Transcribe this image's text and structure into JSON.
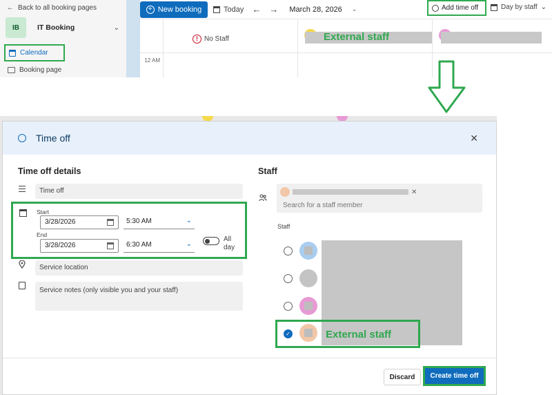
{
  "sidebar": {
    "back_label": "Back to all booking pages",
    "org_initials": "IB",
    "org_name": "IT Booking",
    "items": [
      {
        "label": "Calendar"
      },
      {
        "label": "Booking page"
      }
    ]
  },
  "toolbar": {
    "new_booking": "New booking",
    "today": "Today",
    "date": "March 28, 2026",
    "add_time_off": "Add time off",
    "view_mode": "Day by staff"
  },
  "calendar": {
    "no_staff_label": "No Staff",
    "external_staff_label": "External staff",
    "time_label": "12 AM"
  },
  "dialog": {
    "title": "Time off",
    "details_title": "Time off details",
    "title_field_value": "Time off",
    "start_label": "Start",
    "start_date": "3/28/2026",
    "start_time": "5:30 AM",
    "end_label": "End",
    "end_date": "3/28/2026",
    "end_time": "6:30 AM",
    "all_day_label": "All day",
    "all_day_on": false,
    "location_placeholder": "Service location",
    "notes_placeholder": "Service notes (only visible you and your staff)",
    "staff_title": "Staff",
    "staff_search_placeholder": "Search for a staff member",
    "staff_list_label": "Staff",
    "staff_list": [
      {
        "avatar_color": "#a9cdef",
        "checked": false
      },
      {
        "avatar_color": "#c4c4c4",
        "checked": false
      },
      {
        "avatar_color": "#e79ad4",
        "checked": false
      },
      {
        "avatar_color": "#f2c7a8",
        "checked": true,
        "label": "External staff"
      }
    ],
    "discard_label": "Discard",
    "create_label": "Create time off"
  },
  "colors": {
    "accent": "#0f6cbd",
    "highlight": "#2fa84f"
  }
}
